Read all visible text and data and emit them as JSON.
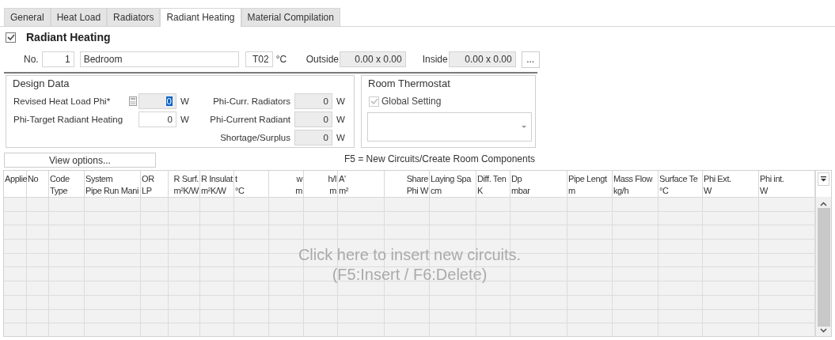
{
  "tabs": [
    {
      "label": "General",
      "selected": false
    },
    {
      "label": "Heat Load",
      "selected": false
    },
    {
      "label": "Radiators",
      "selected": false
    },
    {
      "label": "Radiant Heating",
      "selected": true
    },
    {
      "label": "Material Compilation",
      "selected": false
    }
  ],
  "section": {
    "title": "Radiant Heating",
    "checked": true
  },
  "room": {
    "no_label": "No.",
    "no": "1",
    "name": "Bedroom",
    "code": "T02",
    "unit": "°C",
    "outside_label": "Outside",
    "outside": "0.00 x 0.00",
    "inside_label": "Inside",
    "inside": "0.00 x 0.00",
    "more_button": "..."
  },
  "design_data": {
    "title": "Design Data",
    "left_fields": [
      {
        "label": "Revised Heat Load Phi*",
        "value": "0",
        "unit": "W",
        "readonly": true,
        "calculator": true,
        "text_selected": true
      },
      {
        "label": "Phi-Target Radiant Heating",
        "value": "0",
        "unit": "W",
        "readonly": false,
        "calculator": false,
        "text_selected": false
      }
    ],
    "right_fields": [
      {
        "label": "Phi-Curr. Radiators",
        "value": "0",
        "unit": "W",
        "readonly": true
      },
      {
        "label": "Phi-Current Radiant",
        "value": "0",
        "unit": "W",
        "readonly": true
      },
      {
        "label": "Shortage/Surplus",
        "value": "0",
        "unit": "W",
        "readonly": true
      }
    ]
  },
  "room_thermostat": {
    "title": "Room Thermostat",
    "global_setting": {
      "label": "Global Setting",
      "checked": true,
      "disabled": true
    }
  },
  "view_options_button": "View options...",
  "hint": "F5 = New Circuits/Create Room Components",
  "grid": {
    "columns": [
      {
        "lines": [
          "Applie"
        ]
      },
      {
        "lines": [
          "No"
        ]
      },
      {
        "lines": [
          "Code",
          "Type"
        ]
      },
      {
        "lines": [
          "System",
          "Pipe Run Mani"
        ]
      },
      {
        "lines": [
          "OR",
          "LP"
        ]
      },
      {
        "lines": [
          "R Surf.",
          "m²K/W"
        ]
      },
      {
        "lines": [
          "R Insulat",
          "m²K/W"
        ]
      },
      {
        "lines": [
          "t",
          "°C"
        ]
      },
      {
        "lines": [
          "w",
          "m"
        ]
      },
      {
        "lines": [
          "h/l",
          "m"
        ]
      },
      {
        "lines": [
          "A'",
          "m²"
        ]
      },
      {
        "lines": [
          "Share",
          "Phi W"
        ]
      },
      {
        "lines": [
          "Laying Spa",
          "cm"
        ]
      },
      {
        "lines": [
          "Diff. Ten",
          "K"
        ]
      },
      {
        "lines": [
          "Dp",
          "mbar"
        ]
      },
      {
        "lines": [
          "Pipe Lengt",
          "m"
        ]
      },
      {
        "lines": [
          "Mass Flow",
          "kg/h"
        ]
      },
      {
        "lines": [
          "Surface Te",
          "°C"
        ]
      },
      {
        "lines": [
          "Phi Ext.",
          "W"
        ]
      },
      {
        "lines": [
          "Phi int.",
          "W"
        ]
      }
    ],
    "empty_hint": [
      "Click here to insert new circuits.",
      "(F5:Insert / F6:Delete)"
    ]
  }
}
